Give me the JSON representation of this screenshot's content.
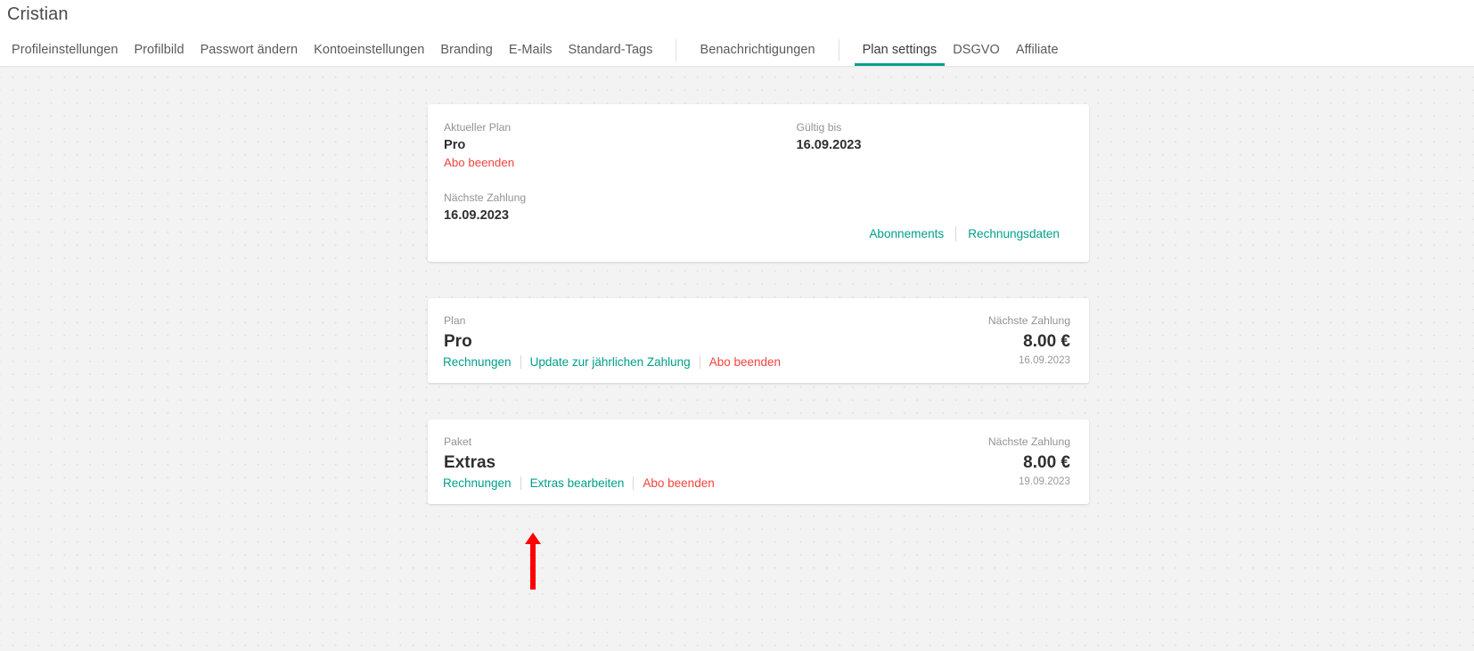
{
  "header": {
    "title": "Cristian",
    "tabs": [
      {
        "label": "Profileinstellungen",
        "active": false,
        "name": "tab-profileinstellungen"
      },
      {
        "label": "Profilbild",
        "active": false,
        "name": "tab-profilbild"
      },
      {
        "label": "Passwort ändern",
        "active": false,
        "name": "tab-passwort-aendern"
      },
      {
        "label": "Kontoeinstellungen",
        "active": false,
        "name": "tab-kontoeinstellungen"
      },
      {
        "label": "Branding",
        "active": false,
        "name": "tab-branding"
      },
      {
        "label": "E-Mails",
        "active": false,
        "name": "tab-e-mails"
      },
      {
        "label": "Standard-Tags",
        "active": false,
        "name": "tab-standard-tags"
      },
      {
        "label": "Benachrichtigungen",
        "active": false,
        "name": "tab-benachrichtigungen"
      },
      {
        "label": "Plan settings",
        "active": true,
        "name": "tab-plan-settings"
      },
      {
        "label": "DSGVO",
        "active": false,
        "name": "tab-dsgvo"
      },
      {
        "label": "Affiliate",
        "active": false,
        "name": "tab-affiliate"
      }
    ]
  },
  "plan_card": {
    "current_plan_label": "Aktueller Plan",
    "current_plan_value": "Pro",
    "cancel_link": "Abo beenden",
    "valid_until_label": "Gültig bis",
    "valid_until_value": "16.09.2023",
    "next_payment_label": "Nächste Zahlung",
    "next_payment_value": "16.09.2023",
    "actions": [
      {
        "label": "Abonnements",
        "name": "abonnements-link"
      },
      {
        "label": "Rechnungsdaten",
        "name": "rechnungsdaten-link"
      }
    ]
  },
  "subscription_cards": [
    {
      "name": "subscription-card-pro",
      "type_label": "Plan",
      "title": "Pro",
      "links": [
        {
          "label": "Rechnungen",
          "style": "teal",
          "name": "rechnungen-link"
        },
        {
          "label": "Update zur jährlichen Zahlung",
          "style": "teal",
          "name": "update-jaehrliche-zahlung-link"
        },
        {
          "label": "Abo beenden",
          "style": "red",
          "name": "abo-beenden-link"
        }
      ],
      "amount_label": "Nächste Zahlung",
      "amount": "8.00 €",
      "amount_date": "16.09.2023"
    },
    {
      "name": "subscription-card-extras",
      "type_label": "Paket",
      "title": "Extras",
      "links": [
        {
          "label": "Rechnungen",
          "style": "teal",
          "name": "rechnungen-link"
        },
        {
          "label": "Extras bearbeiten",
          "style": "teal",
          "name": "extras-bearbeiten-link"
        },
        {
          "label": "Abo beenden",
          "style": "red",
          "name": "abo-beenden-link"
        }
      ],
      "amount_label": "Nächste Zahlung",
      "amount": "8.00 €",
      "amount_date": "19.09.2023"
    }
  ],
  "annotation": {
    "type": "arrow-up",
    "color": "#ff0000",
    "points_to": "Extras bearbeiten"
  },
  "colors": {
    "accent_teal": "#00a08a",
    "danger_red": "#f4433c",
    "annotation_red": "#ff0000",
    "page_background": "#f3f3f3",
    "card_background": "#ffffff"
  }
}
